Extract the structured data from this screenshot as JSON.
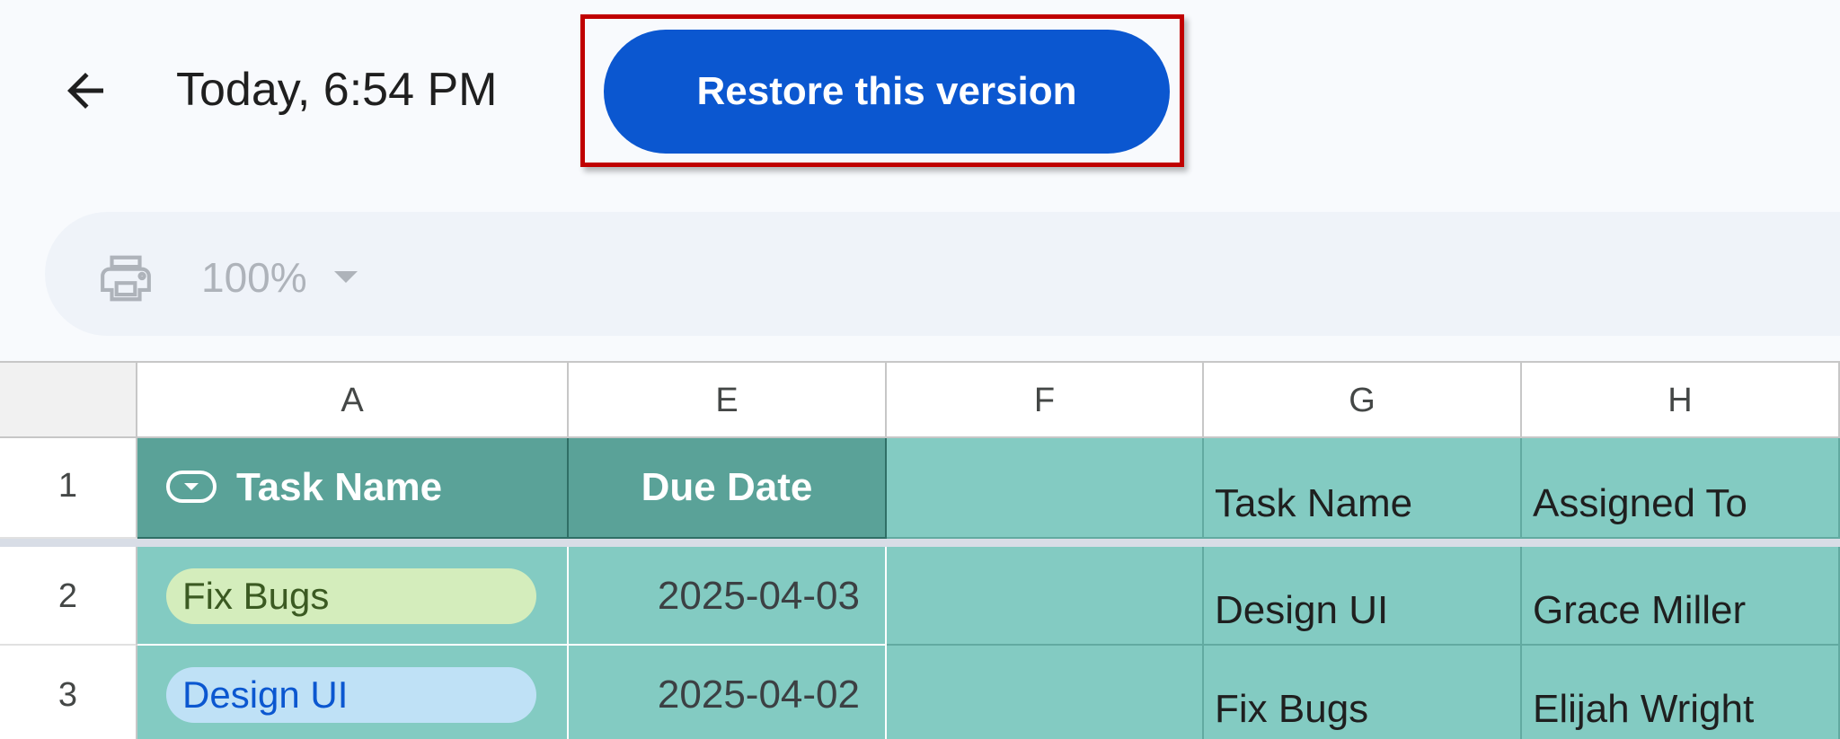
{
  "header": {
    "back_icon": "arrow-left-icon",
    "version_time": "Today, 6:54 PM",
    "restore_label": "Restore this version"
  },
  "toolbar": {
    "print_icon": "printer-icon",
    "zoom_value": "100%",
    "zoom_dropdown_icon": "caret-down-icon"
  },
  "sheet": {
    "columns": [
      "A",
      "E",
      "F",
      "G",
      "H"
    ],
    "rows": [
      "1",
      "2",
      "3"
    ],
    "table": {
      "header_icon": "dropdown-chip-icon",
      "headers": [
        "Task Name",
        "Due Date"
      ],
      "rows": [
        {
          "task": "Fix Bugs",
          "due": "2025-04-03",
          "chip_color": "#d4edbc"
        },
        {
          "task": "Design UI",
          "due": "2025-04-02",
          "chip_color": "#bfe1f6"
        }
      ]
    },
    "lookup": {
      "headers": [
        "Task Name",
        "Assigned To"
      ],
      "rows": [
        [
          "Design UI",
          "Grace Miller"
        ],
        [
          "Fix Bugs",
          "Elijah Wright"
        ]
      ]
    }
  },
  "colors": {
    "accent": "#0b57d0",
    "highlight_border": "#c00000",
    "table_header": "#5aa298",
    "table_body": "#83cbc2"
  }
}
